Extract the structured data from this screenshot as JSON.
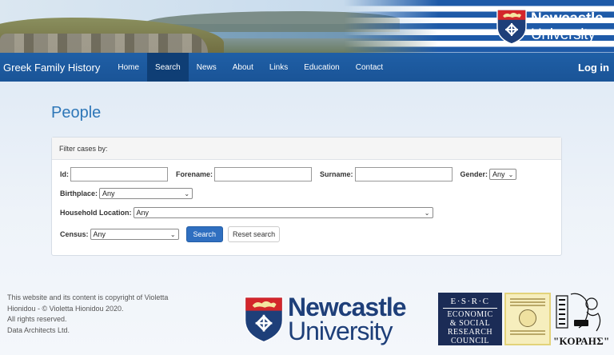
{
  "banner": {
    "logo_line1": "Newcastle",
    "logo_line2": "University"
  },
  "nav": {
    "brand": "Greek Family History",
    "items": [
      {
        "label": "Home",
        "active": false
      },
      {
        "label": "Search",
        "active": true
      },
      {
        "label": "News",
        "active": false
      },
      {
        "label": "About",
        "active": false
      },
      {
        "label": "Links",
        "active": false
      },
      {
        "label": "Education",
        "active": false
      },
      {
        "label": "Contact",
        "active": false
      }
    ],
    "login": "Log in"
  },
  "page": {
    "title": "People"
  },
  "filter": {
    "heading": "Filter cases by:",
    "id_label": "Id:",
    "id_value": "",
    "forename_label": "Forename:",
    "forename_value": "",
    "surname_label": "Surname:",
    "surname_value": "",
    "gender_label": "Gender:",
    "gender_value": "Any",
    "birthplace_label": "Birthplace:",
    "birthplace_value": "Any",
    "household_label": "Household Location:",
    "household_value": "Any",
    "census_label": "Census:",
    "census_value": "Any",
    "search_button": "Search",
    "reset_button": "Reset search"
  },
  "footer": {
    "copyright_lines": [
      "This website and its content is copyright of Violetta",
      "Hionidou - © Violetta Hionidou 2020.",
      "All rights reserved.",
      "Data Architects Ltd."
    ],
    "nu_line1": "Newcastle",
    "nu_line2": "University",
    "esrc_top": "E·S·R·C",
    "esrc_words": [
      "ECONOMIC",
      "& SOCIAL",
      "RESEARCH",
      "COUNCIL"
    ],
    "korais_label": "\"ΚΟΡΑΗΣ\""
  },
  "colors": {
    "nav_bg": "#1f5fa6",
    "nav_active": "#0f3e75",
    "title": "#2e77b8",
    "primary_button": "#2f6fc0",
    "nu_blue": "#1e3f79",
    "nu_red": "#d3262b",
    "esrc_bg": "#1b2c56"
  }
}
